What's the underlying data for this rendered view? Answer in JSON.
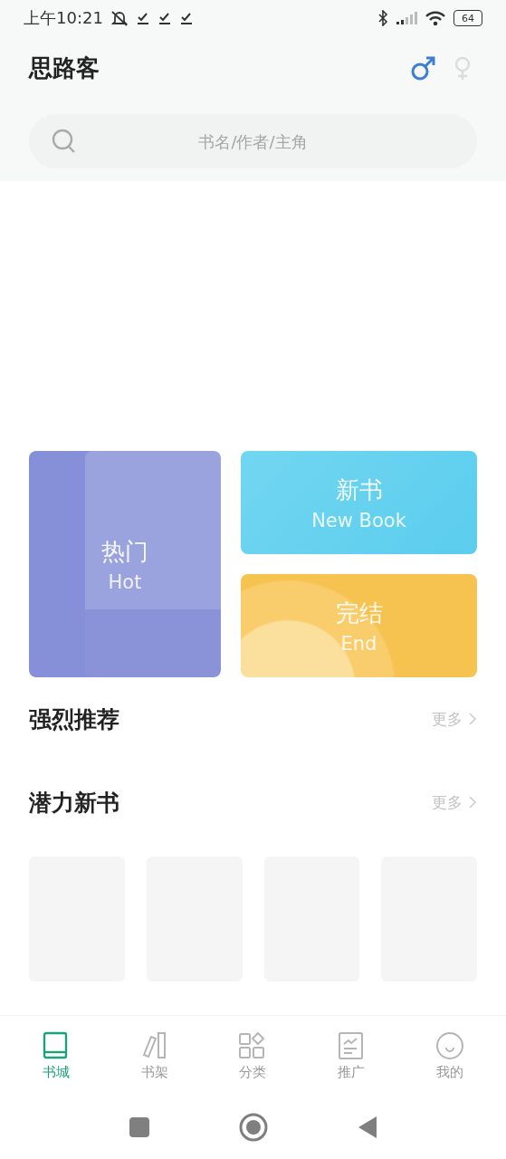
{
  "status_bar": {
    "time": "上午10:21",
    "battery": "64"
  },
  "header": {
    "title": "思路客",
    "genders": [
      {
        "kind": "male",
        "selected": true
      },
      {
        "kind": "female",
        "selected": false
      }
    ]
  },
  "search": {
    "placeholder": "书名/作者/主角"
  },
  "categories": [
    {
      "kind": "hot",
      "title": "热门",
      "subtitle": "Hot"
    },
    {
      "kind": "new",
      "title": "新书",
      "subtitle": "New Book"
    },
    {
      "kind": "end",
      "title": "完结",
      "subtitle": "End"
    }
  ],
  "sections": [
    {
      "title": "强烈推荐",
      "more": "更多"
    },
    {
      "title": "潜力新书",
      "more": "更多",
      "book_slots": [
        {
          "kind": "empty"
        },
        {
          "kind": "empty"
        },
        {
          "kind": "empty"
        },
        {
          "kind": "empty"
        }
      ]
    }
  ],
  "tabs": [
    {
      "kind": "store",
      "label": "书城",
      "selected": true
    },
    {
      "kind": "shelf",
      "label": "书架",
      "selected": false
    },
    {
      "kind": "category",
      "label": "分类",
      "selected": false
    },
    {
      "kind": "promo",
      "label": "推广",
      "selected": false
    },
    {
      "kind": "me",
      "label": "我的",
      "selected": false
    }
  ]
}
